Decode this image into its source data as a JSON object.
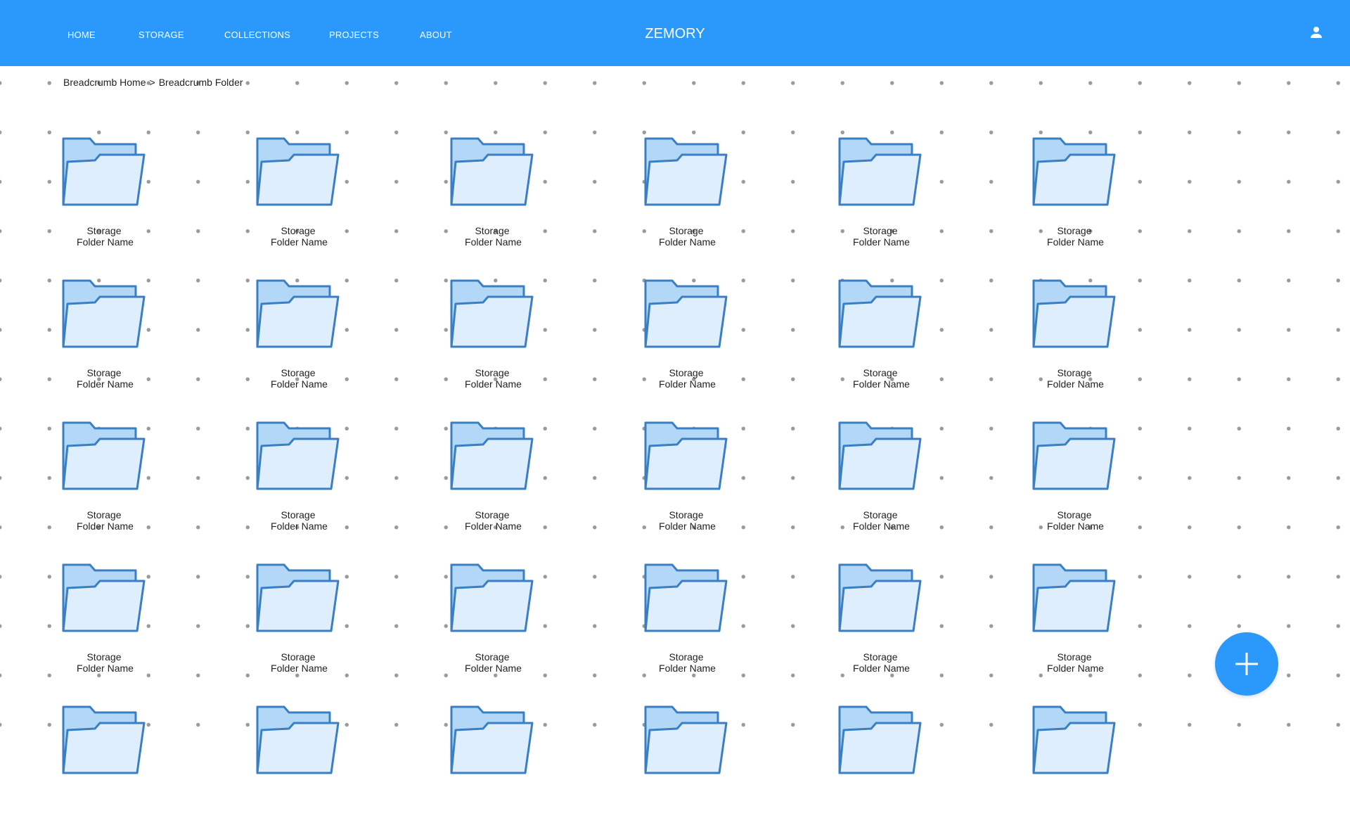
{
  "nav": {
    "items": [
      {
        "label": "HOME"
      },
      {
        "label": "STORAGE"
      },
      {
        "label": "COLLECTIONS"
      },
      {
        "label": "PROJECTS"
      },
      {
        "label": "ABOUT"
      }
    ],
    "brand": "ZEMORY",
    "user_icon": "person-icon"
  },
  "breadcrumb": {
    "home": "Breadcrumb Home",
    "separator": ">",
    "current": "Breadcrumb Folder"
  },
  "folders": {
    "icon": "folder-open-icon",
    "items": [
      {
        "line1": "Storage",
        "line2": "Folder Name"
      },
      {
        "line1": "Storage",
        "line2": "Folder Name"
      },
      {
        "line1": "Storage",
        "line2": "Folder Name"
      },
      {
        "line1": "Storage",
        "line2": "Folder Name"
      },
      {
        "line1": "Storage",
        "line2": "Folder Name"
      },
      {
        "line1": "Storage",
        "line2": "Folder Name"
      },
      {
        "line1": "Storage",
        "line2": "Folder Name"
      },
      {
        "line1": "Storage",
        "line2": "Folder Name"
      },
      {
        "line1": "Storage",
        "line2": "Folder Name"
      },
      {
        "line1": "Storage",
        "line2": "Folder Name"
      },
      {
        "line1": "Storage",
        "line2": "Folder Name"
      },
      {
        "line1": "Storage",
        "line2": "Folder Name"
      },
      {
        "line1": "Storage",
        "line2": "Folder Name"
      },
      {
        "line1": "Storage",
        "line2": "Folder Name"
      },
      {
        "line1": "Storage",
        "line2": "Folder Name"
      },
      {
        "line1": "Storage",
        "line2": "Folder Name"
      },
      {
        "line1": "Storage",
        "line2": "Folder Name"
      },
      {
        "line1": "Storage",
        "line2": "Folder Name"
      },
      {
        "line1": "Storage",
        "line2": "Folder Name"
      },
      {
        "line1": "Storage",
        "line2": "Folder Name"
      },
      {
        "line1": "Storage",
        "line2": "Folder Name"
      },
      {
        "line1": "Storage",
        "line2": "Folder Name"
      },
      {
        "line1": "Storage",
        "line2": "Folder Name"
      },
      {
        "line1": "Storage",
        "line2": "Folder Name"
      },
      {
        "line1": "",
        "line2": ""
      },
      {
        "line1": "",
        "line2": ""
      },
      {
        "line1": "",
        "line2": ""
      },
      {
        "line1": "",
        "line2": ""
      },
      {
        "line1": "",
        "line2": ""
      },
      {
        "line1": "",
        "line2": ""
      }
    ]
  },
  "fab": {
    "icon": "plus-icon"
  },
  "colors": {
    "primary": "#2a99fb",
    "folder_stroke": "#3a7fc4",
    "folder_back": "#b3d7f7",
    "folder_front": "#dfeefc",
    "dot": "#9a9a9a"
  }
}
